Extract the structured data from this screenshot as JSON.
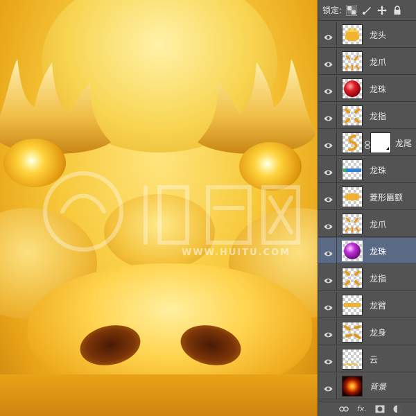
{
  "watermark": {
    "text": "WWW.HUITU.COM"
  },
  "panel": {
    "lock_label": "锁定:",
    "lock_icons": [
      "transparent-pixels-lock-icon",
      "brush-lock-icon",
      "move-lock-icon",
      "padlock-icon"
    ],
    "layers": [
      {
        "name": "龙头",
        "thumb": "dragon-head",
        "selected": false,
        "has_mask": false
      },
      {
        "name": "龙爪",
        "thumb": "claw",
        "selected": false,
        "has_mask": false
      },
      {
        "name": "龙珠",
        "thumb": "red-pearl",
        "selected": false,
        "has_mask": false
      },
      {
        "name": "龙指",
        "thumb": "finger",
        "selected": false,
        "has_mask": false
      },
      {
        "name": "龙尾",
        "thumb": "tail",
        "selected": false,
        "has_mask": true
      },
      {
        "name": "龙珠",
        "thumb": "blue-bar",
        "selected": false,
        "has_mask": false
      },
      {
        "name": "菱形匾额",
        "thumb": "plaque",
        "selected": false,
        "has_mask": false
      },
      {
        "name": "龙爪",
        "thumb": "claw",
        "selected": false,
        "has_mask": false
      },
      {
        "name": "龙珠",
        "thumb": "purple-pearl",
        "selected": true,
        "has_mask": false
      },
      {
        "name": "龙指",
        "thumb": "finger",
        "selected": false,
        "has_mask": false
      },
      {
        "name": "龙臂",
        "thumb": "arm",
        "selected": false,
        "has_mask": false
      },
      {
        "name": "龙身",
        "thumb": "body",
        "selected": false,
        "has_mask": false
      },
      {
        "name": "云",
        "thumb": "cloud",
        "selected": false,
        "has_mask": false
      },
      {
        "name": "背景",
        "thumb": "background-glow",
        "selected": false,
        "has_mask": false,
        "italic": true
      }
    ],
    "bottom_buttons": [
      "link-icon",
      "fx",
      "mask-icon",
      "adjustment-icon"
    ],
    "bottom_fx_label": "fx."
  },
  "colors": {
    "panel_bg": "#535353",
    "selected_row": "#5a6a85",
    "dragon_gold": "#f7c93a"
  }
}
